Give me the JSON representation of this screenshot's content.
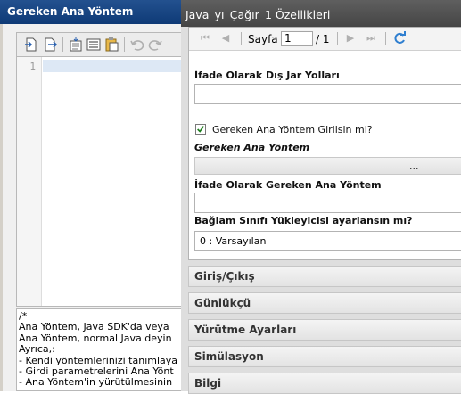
{
  "left_dialog": {
    "title": "Gereken Ana Yöntem",
    "toolbar_icons": [
      "page-import-icon",
      "page-export-icon",
      "insert-icon",
      "list-icon",
      "clipboard-icon",
      "undo-icon",
      "redo-icon"
    ],
    "editor": {
      "line_number": "1",
      "code": ""
    },
    "comment_text": "/*\nAna Yöntem, Java SDK'da veya\nAna Yöntem, normal Java deyin\nAyrıca,:\n- Kendi yöntemlerinizi tanımlaya\n- Girdi parametrelerini Ana Yönt\n- Ana Yöntem'in yürütülmesinin"
  },
  "properties_dialog": {
    "title": "Java_yı_Çağır_1 Özellikleri",
    "pager": {
      "page_label": "Sayfa",
      "page_value": "1",
      "page_total": "/ 1"
    },
    "fields": {
      "external_jar_label": "İfade Olarak Dış Jar Yolları",
      "external_jar_value": "",
      "checkbox_label": "Gereken Ana Yöntem Girilsin mi?",
      "checkbox_checked": true,
      "main_method_label": "Gereken Ana Yöntem",
      "main_method_button": "...",
      "main_method_expr_label": "İfade Olarak Gereken Ana Yöntem",
      "main_method_expr_value": "",
      "classloader_label": "Bağlam Sınıfı Yükleyicisi ayarlansın mı?",
      "classloader_value": "0 : Varsayılan"
    },
    "sections": [
      "Giriş/Çıkış",
      "Günlükçü",
      "Yürütme Ayarları",
      "Simülasyon",
      "Bilgi"
    ]
  },
  "colors": {
    "left_title_bg": "#1a4785",
    "right_title_bg": "#525252",
    "refresh_icon": "#2f7fd0"
  }
}
